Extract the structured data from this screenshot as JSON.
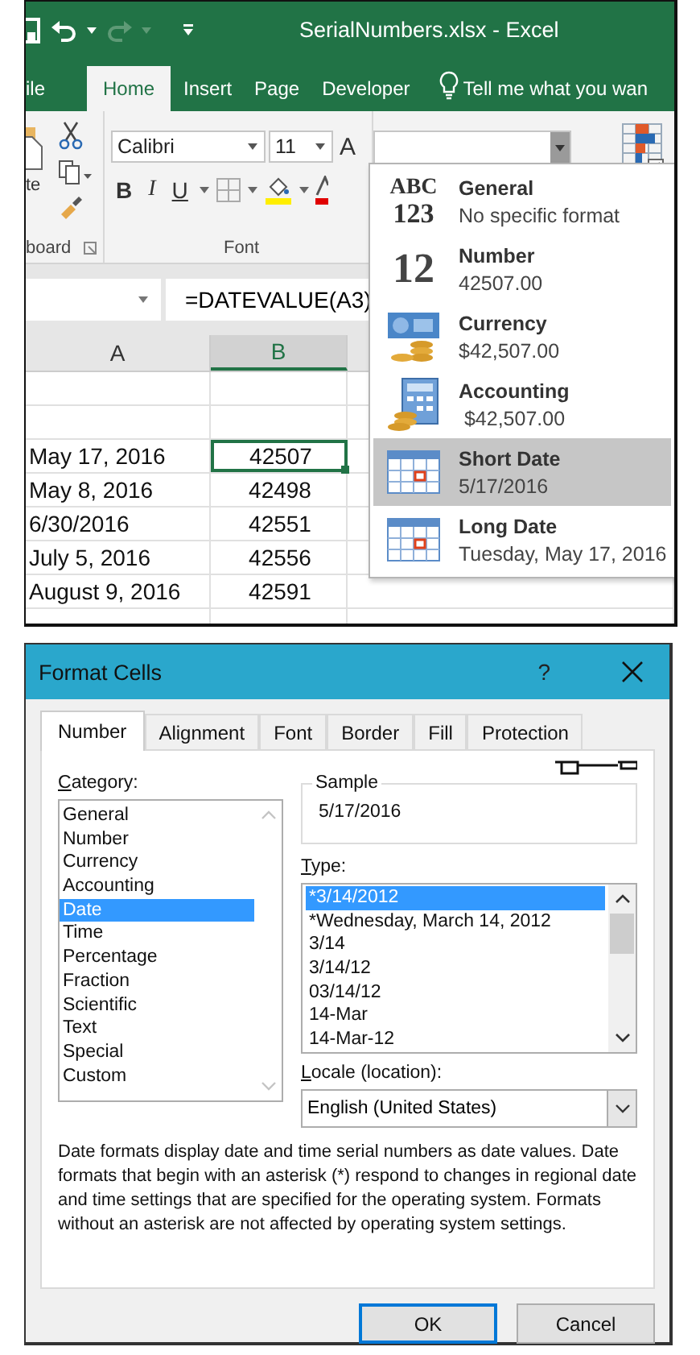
{
  "window": {
    "title": "SerialNumbers.xlsx - Excel"
  },
  "ribbon_tabs": [
    {
      "label": "ile",
      "selected": false
    },
    {
      "label": "Home",
      "selected": true
    },
    {
      "label": "Insert",
      "selected": false
    },
    {
      "label": "Page",
      "selected": false
    },
    {
      "label": "Developer",
      "selected": false
    }
  ],
  "tell_me": "Tell me what you wan",
  "clipboard_group": {
    "paste_label": "te",
    "group_label": "board"
  },
  "font_group": {
    "font_name": "Calibri",
    "font_size": "11",
    "grow_font": "A",
    "bold": "B",
    "italic": "I",
    "underline": "U",
    "group_label": "Font"
  },
  "number_format_menu": [
    {
      "kind": "glyph",
      "glyph": [
        "ABC",
        "123"
      ],
      "name": "General",
      "example": "No specific format",
      "selected": false
    },
    {
      "kind": "glyph",
      "glyph": [
        "12"
      ],
      "name": "Number",
      "example": "42507.00",
      "selected": false
    },
    {
      "kind": "currency",
      "name": "Currency",
      "example": "$42,507.00",
      "selected": false
    },
    {
      "kind": "accounting",
      "name": "Accounting",
      "example": " $42,507.00",
      "selected": false
    },
    {
      "kind": "calendar",
      "name": "Short Date",
      "example": "5/17/2016",
      "selected": true
    },
    {
      "kind": "calendar",
      "name": "Long Date",
      "example": "Tuesday, May 17, 2016",
      "selected": false
    }
  ],
  "formula_bar": {
    "formula": "=DATEVALUE(A3)"
  },
  "sheet": {
    "columns": [
      {
        "label": "A",
        "selected": false
      },
      {
        "label": "B",
        "selected": true
      }
    ],
    "rows": [
      {
        "a": "May 17, 2016",
        "b": "42507",
        "selected": true
      },
      {
        "a": "May 8, 2016",
        "b": "42498",
        "selected": false
      },
      {
        "a": "6/30/2016",
        "b": "42551",
        "selected": false
      },
      {
        "a": "July 5, 2016",
        "b": "42556",
        "selected": false
      },
      {
        "a": "August 9, 2016",
        "b": "42591",
        "selected": false
      }
    ]
  },
  "dialog": {
    "title": "Format Cells",
    "help": "?",
    "tabs": [
      {
        "label": "Number",
        "selected": true
      },
      {
        "label": "Alignment",
        "selected": false
      },
      {
        "label": "Font",
        "selected": false
      },
      {
        "label": "Border",
        "selected": false
      },
      {
        "label": "Fill",
        "selected": false
      },
      {
        "label": "Protection",
        "selected": false
      }
    ],
    "category_label": "Category:",
    "categories": [
      {
        "label": "General",
        "selected": false
      },
      {
        "label": "Number",
        "selected": false
      },
      {
        "label": "Currency",
        "selected": false
      },
      {
        "label": "Accounting",
        "selected": false
      },
      {
        "label": "Date",
        "selected": true
      },
      {
        "label": "Time",
        "selected": false
      },
      {
        "label": "Percentage",
        "selected": false
      },
      {
        "label": "Fraction",
        "selected": false
      },
      {
        "label": "Scientific",
        "selected": false
      },
      {
        "label": "Text",
        "selected": false
      },
      {
        "label": "Special",
        "selected": false
      },
      {
        "label": "Custom",
        "selected": false
      }
    ],
    "sample_label": "Sample",
    "sample": "5/17/2016",
    "type_label": "Type:",
    "types": [
      {
        "label": "*3/14/2012",
        "selected": true
      },
      {
        "label": "*Wednesday, March 14, 2012",
        "selected": false
      },
      {
        "label": "3/14",
        "selected": false
      },
      {
        "label": "3/14/12",
        "selected": false
      },
      {
        "label": "03/14/12",
        "selected": false
      },
      {
        "label": "14-Mar",
        "selected": false
      },
      {
        "label": "14-Mar-12",
        "selected": false
      }
    ],
    "locale_label": "Locale (location):",
    "locale": "English (United States)",
    "description": "Date formats display date and time serial numbers as date values.  Date formats that begin with an asterisk (*) respond to changes in regional date and time settings that are specified for the operating system. Formats without an asterisk are not affected by operating system settings.",
    "buttons": [
      {
        "label": "OK",
        "kind": "default"
      },
      {
        "label": "Cancel",
        "kind": "normal"
      }
    ]
  }
}
